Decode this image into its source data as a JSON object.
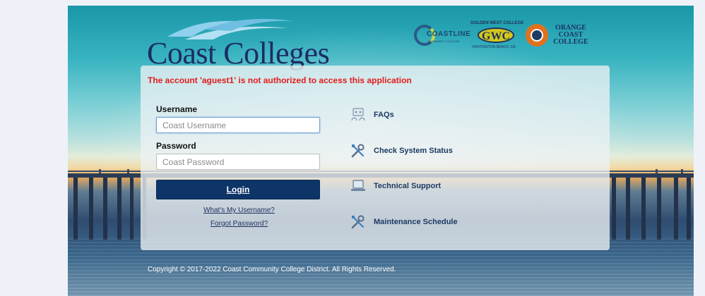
{
  "brand": {
    "logo_text": "Coast Colleges",
    "partners": [
      {
        "name": "COASTLINE",
        "sub": "COMMUNITY COLLEGE"
      },
      {
        "name": "GWC",
        "arc": "GOLDEN WEST COLLEGE",
        "sub": "HUNTINGTON BEACH, CA"
      },
      {
        "name": "ORANGE COAST COLLEGE",
        "lines": [
          "ORANGE",
          "COAST",
          "COLLEGE"
        ]
      }
    ]
  },
  "error_message": "The account 'aguest1' is not authorized to access this application",
  "form": {
    "username_label": "Username",
    "username_placeholder": "Coast Username",
    "username_value": "",
    "password_label": "Password",
    "password_placeholder": "Coast Password",
    "password_value": "",
    "login_label": "Login",
    "whats_username": "What's My Username?",
    "forgot_password": "Forgot Password?"
  },
  "side_links": [
    {
      "label": "FAQs",
      "icon": "faq-icon"
    },
    {
      "label": "Check System Status",
      "icon": "tools-icon"
    },
    {
      "label": "Technical Support",
      "icon": "laptop-icon"
    },
    {
      "label": "Maintenance Schedule",
      "icon": "tools-icon"
    }
  ],
  "footer": "Copyright © 2017-2022 Coast Community College District. All Rights Reserved.",
  "colors": {
    "navy": "#0e3568",
    "error": "#e31b1b",
    "link": "#1d3b63"
  }
}
